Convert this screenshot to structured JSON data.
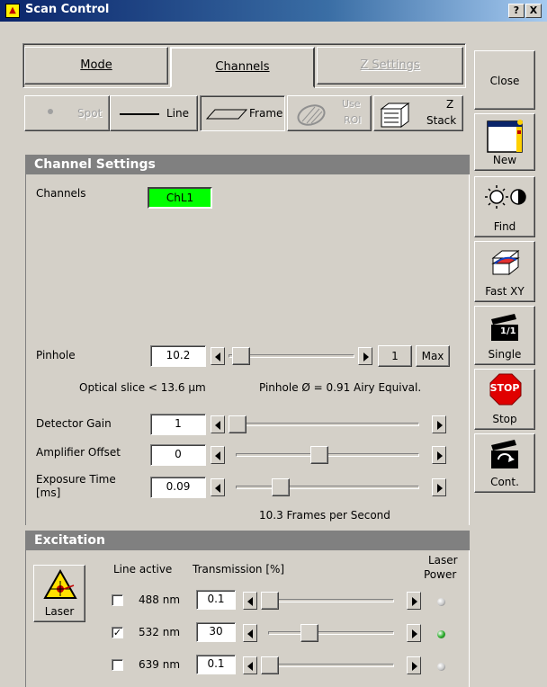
{
  "window": {
    "title": "Scan Control",
    "help_btn": "?",
    "close_btn": "X",
    "title_icon": "laser-warning-icon"
  },
  "tabs": [
    {
      "label": "Mode",
      "active": false,
      "disabled": false
    },
    {
      "label": "Channels",
      "active": true,
      "disabled": false
    },
    {
      "label": "Z Settings",
      "active": false,
      "disabled": true
    }
  ],
  "scan_modes": {
    "spot": "Spot",
    "line": "Line",
    "frame": "Frame",
    "use_roi_1": "Use",
    "use_roi_2": "ROI",
    "zstack_1": "Z",
    "zstack_2": "Stack"
  },
  "channel_settings": {
    "header": "Channel Settings",
    "channels_label": "Channels",
    "channel_button": "ChL1",
    "channel_color": "#00ff00",
    "pinhole": {
      "label": "Pinhole",
      "value": "10.2",
      "step": "1",
      "max_label": "Max",
      "slider_pos": 0.03
    },
    "optical_slice": "Optical slice < 13.6 µm",
    "pinhole_airy": "Pinhole Ø = 0.91 Airy Equival.",
    "detector_gain": {
      "label": "Detector Gain",
      "value": "1",
      "slider_pos": 0.0
    },
    "amplifier_offset": {
      "label": "Amplifier Offset",
      "value": "0",
      "slider_pos": 0.45
    },
    "exposure": {
      "label_1": "Exposure Time",
      "label_2": "[ms]",
      "value": "0.09",
      "slider_pos": 0.22
    },
    "frames_per_second": "10.3 Frames per Second"
  },
  "excitation": {
    "header": "Excitation",
    "laser_button": "Laser",
    "line_active_label": "Line active",
    "transmission_label": "Transmission [%]",
    "laser_power_1": "Laser",
    "laser_power_2": "Power",
    "lines": [
      {
        "checked": false,
        "check_mark": "",
        "wavelength": "488 nm",
        "transmission": "0.1",
        "slider_pos": 0.0,
        "led_color": "#c8c8c8"
      },
      {
        "checked": true,
        "check_mark": "✓",
        "wavelength": "532 nm",
        "transmission": "30",
        "slider_pos": 0.3,
        "led_color": "#22aa22"
      },
      {
        "checked": false,
        "check_mark": "",
        "wavelength": "639 nm",
        "transmission": "0.1",
        "slider_pos": 0.0,
        "led_color": "#c8c8c8"
      }
    ]
  },
  "side_buttons": {
    "close": "Close",
    "new": "New",
    "find": "Find",
    "fast_xy": "Fast XY",
    "single": "Single",
    "stop": "Stop",
    "stop_sign": "STOP",
    "cont": "Cont.",
    "single_icon_text": "1/1"
  }
}
